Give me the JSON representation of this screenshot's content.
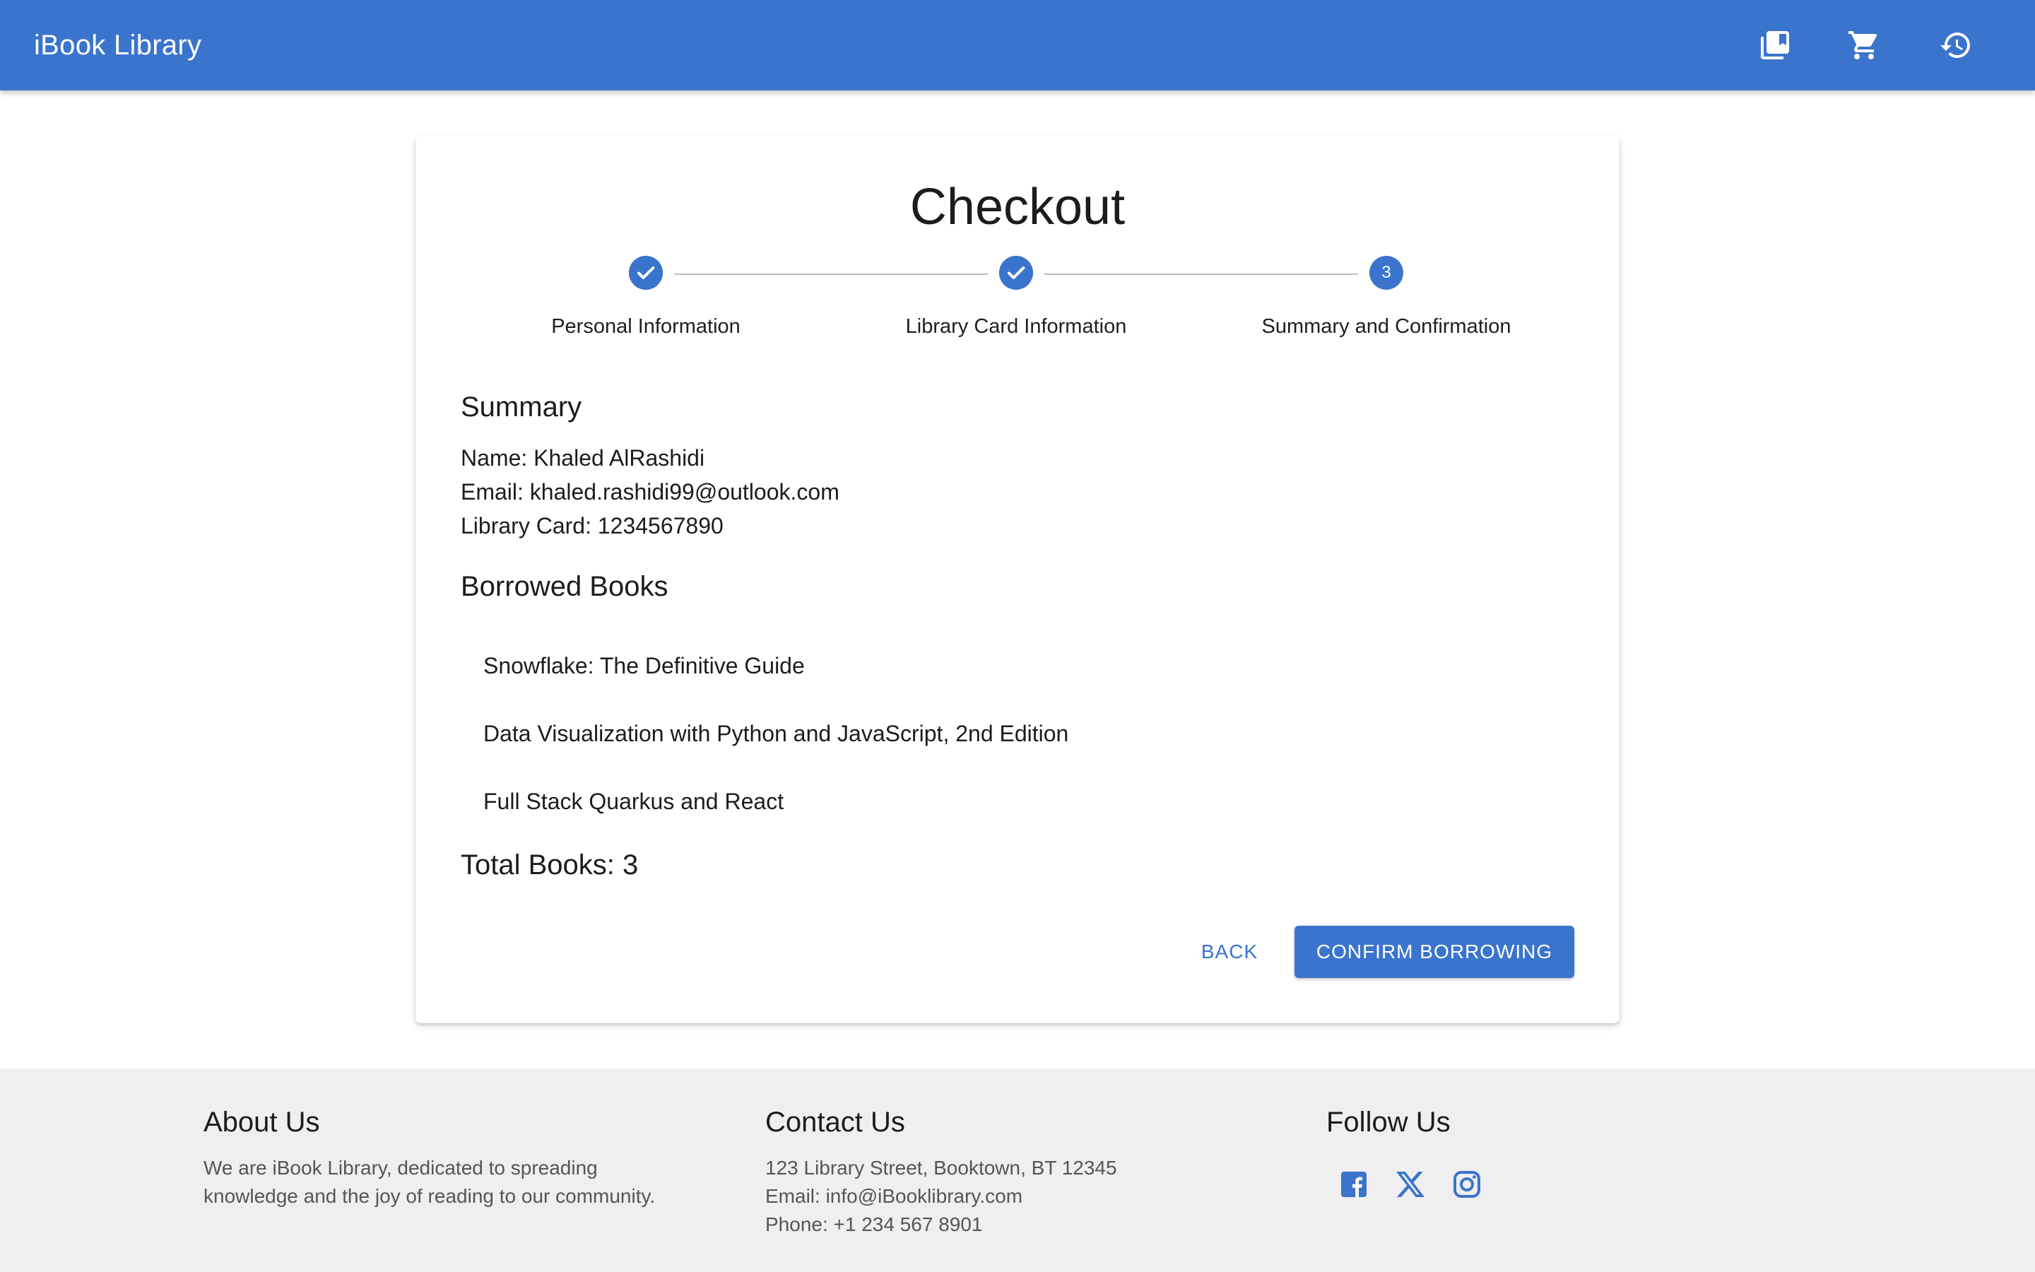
{
  "appbar": {
    "title": "iBook Library",
    "icons": [
      "library-books-icon",
      "shopping-cart-icon",
      "history-icon"
    ],
    "color": "#3a74cc"
  },
  "checkout": {
    "title": "Checkout",
    "steps": [
      {
        "label": "Personal Information",
        "status": "completed"
      },
      {
        "label": "Library Card Information",
        "status": "completed"
      },
      {
        "label": "Summary and Confirmation",
        "status": "active",
        "number": "3"
      }
    ],
    "summary": {
      "heading": "Summary",
      "name": "Name: Khaled AlRashidi",
      "email": "Email: khaled.rashidi99@outlook.com",
      "library_card": "Library Card: 1234567890"
    },
    "borrowed": {
      "heading": "Borrowed Books",
      "books": [
        "Snowflake: The Definitive Guide",
        "Data Visualization with Python and JavaScript, 2nd Edition",
        "Full Stack Quarkus and React"
      ]
    },
    "total": "Total Books: 3",
    "back_label": "BACK",
    "confirm_label": "CONFIRM BORROWING"
  },
  "footer": {
    "about": {
      "heading": "About Us",
      "line1": "We are iBook Library, dedicated to spreading",
      "line2": "knowledge and the joy of reading to our community."
    },
    "contact": {
      "heading": "Contact Us",
      "address": "123 Library Street, Booktown, BT 12345",
      "email": "Email: info@iBooklibrary.com",
      "phone": "Phone: +1 234 567 8901"
    },
    "follow": {
      "heading": "Follow Us",
      "icons": [
        "facebook-icon",
        "x-icon",
        "instagram-icon"
      ]
    }
  }
}
